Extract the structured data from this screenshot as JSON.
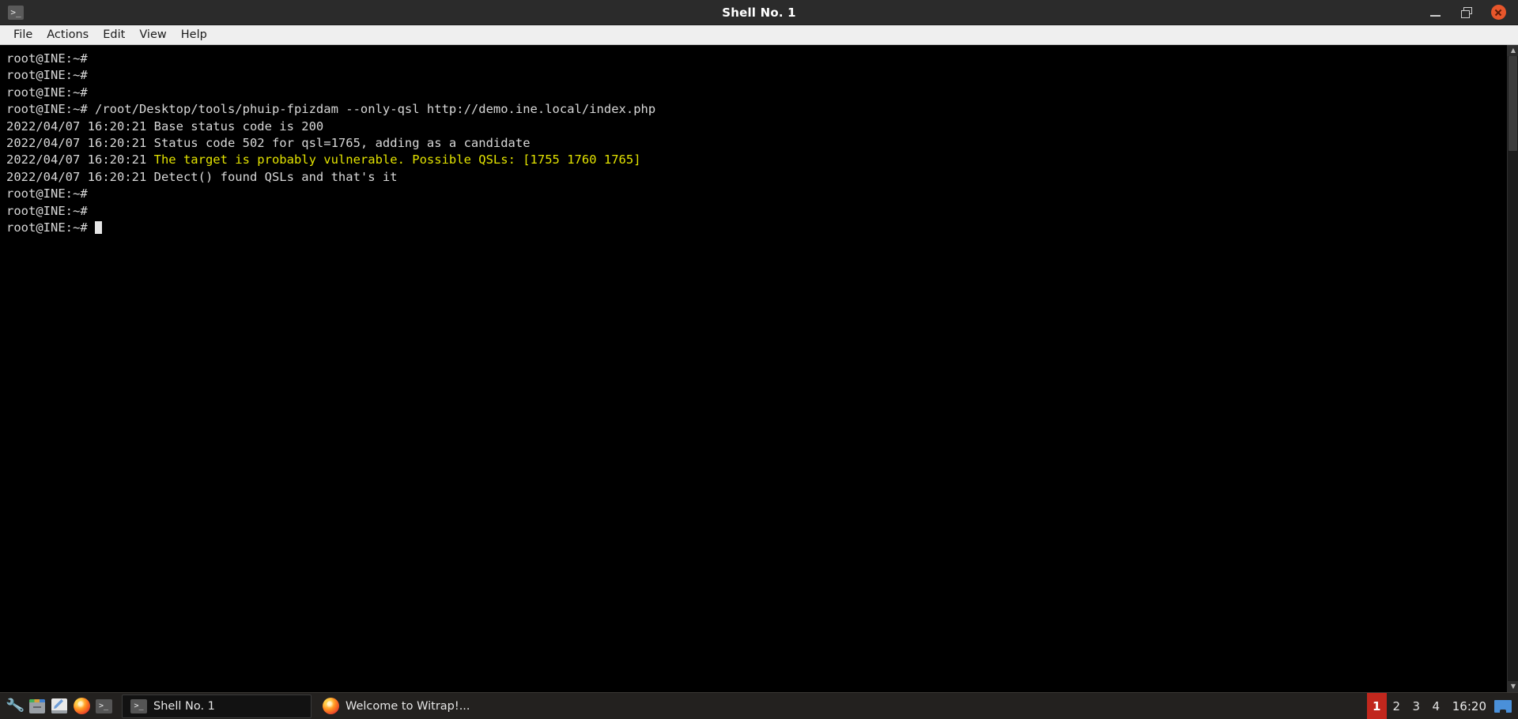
{
  "window": {
    "title": "Shell No. 1",
    "app_icon": ">_",
    "controls": {
      "minimize": "minimize",
      "maximize": "maximize",
      "close": "close"
    }
  },
  "menubar": {
    "items": [
      {
        "label": "File"
      },
      {
        "label": "Actions"
      },
      {
        "label": "Edit"
      },
      {
        "label": "View"
      },
      {
        "label": "Help"
      }
    ]
  },
  "terminal": {
    "prompt": "root@INE:~#",
    "lines": [
      {
        "text": "root@INE:~#",
        "color": "default"
      },
      {
        "text": "root@INE:~#",
        "color": "default"
      },
      {
        "text": "root@INE:~#",
        "color": "default"
      },
      {
        "text": "root@INE:~# /root/Desktop/tools/phuip-fpizdam --only-qsl http://demo.ine.local/index.php",
        "color": "default"
      },
      {
        "text": "2022/04/07 16:20:21 Base status code is 200",
        "color": "default"
      },
      {
        "text": "2022/04/07 16:20:21 Status code 502 for qsl=1765, adding as a candidate",
        "color": "default"
      },
      {
        "prefix": "2022/04/07 16:20:21 ",
        "text": "The target is probably vulnerable. Possible QSLs: [1755 1760 1765]",
        "color": "yellow"
      },
      {
        "text": "2022/04/07 16:20:21 Detect() found QSLs and that's it",
        "color": "default"
      },
      {
        "text": "root@INE:~#",
        "color": "default"
      },
      {
        "text": "root@INE:~#",
        "color": "default"
      },
      {
        "text": "root@INE:~# ",
        "color": "default",
        "cursor": true
      }
    ],
    "command": "/root/Desktop/tools/phuip-fpizdam --only-qsl http://demo.ine.local/index.php",
    "colors": {
      "background": "#000000",
      "foreground": "#d8d8d8",
      "highlight": "#e3e300"
    }
  },
  "taskbar": {
    "launchers": [
      {
        "name": "tools-wrench",
        "glyph": "⚒"
      },
      {
        "name": "file-manager",
        "glyph": ""
      },
      {
        "name": "text-editor",
        "glyph": ""
      },
      {
        "name": "firefox",
        "glyph": ""
      },
      {
        "name": "terminal",
        "glyph": ">_"
      }
    ],
    "tasks": [
      {
        "label": "Shell No. 1",
        "icon": ">_",
        "active": true
      },
      {
        "label": "Welcome to Witrap!...",
        "icon": "firefox",
        "active": false
      }
    ],
    "workspaces": [
      {
        "label": "1",
        "active": true
      },
      {
        "label": "2",
        "active": false
      },
      {
        "label": "3",
        "active": false
      },
      {
        "label": "4",
        "active": false
      }
    ],
    "clock": "16:20"
  }
}
